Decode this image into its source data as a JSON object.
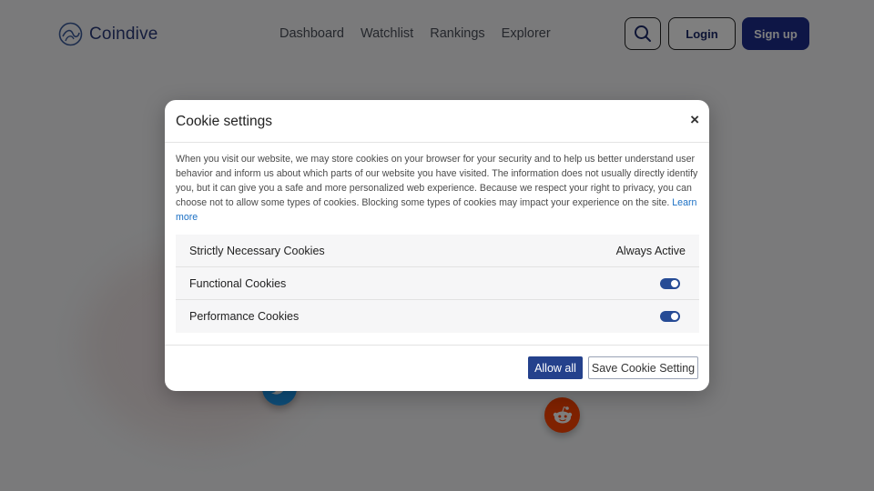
{
  "header": {
    "brand": "Coindive",
    "nav": [
      "Dashboard",
      "Watchlist",
      "Rankings",
      "Explorer"
    ],
    "login_label": "Login",
    "signup_label": "Sign up"
  },
  "modal": {
    "title": "Cookie settings",
    "close_label": "×",
    "description": "When you visit our website, we may store cookies on your browser for your security and to help us better understand user behavior and inform us about which parts of our website you have visited. The information does not usually directly identify you, but it can give you a safe and more personalized web experience. Because we respect your right to privacy, you can choose not to allow some types of cookies. Blocking some types of cookies may impact your experience on the site.",
    "learn_more": "Learn more",
    "categories": [
      {
        "label": "Strictly Necessary Cookies",
        "status": "Always Active"
      },
      {
        "label": "Functional Cookies",
        "enabled": true
      },
      {
        "label": "Performance Cookies",
        "enabled": true
      }
    ],
    "allow_all_label": "Allow all",
    "save_label": "Save Cookie Setting"
  },
  "colors": {
    "brand": "#2b3a7a",
    "primary_button": "#1c2d8c",
    "toggle_on": "#264b95",
    "link": "#1a6fc4"
  }
}
